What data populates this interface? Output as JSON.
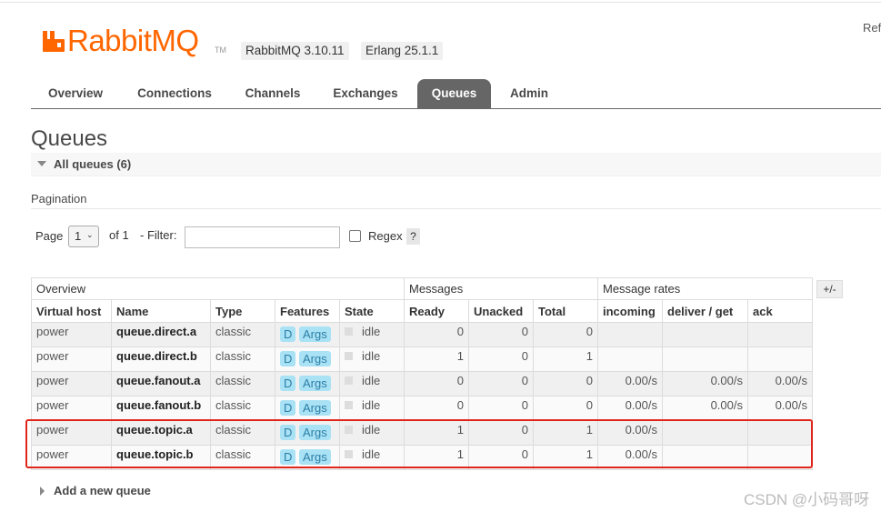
{
  "header": {
    "logo_text": "RabbitMQ",
    "logo_tm": "TM",
    "version_rabbit": "RabbitMQ 3.10.11",
    "version_erlang": "Erlang 25.1.1",
    "ref_text": "Ref",
    "brand_color": "#ff6600"
  },
  "tabs": [
    "Overview",
    "Connections",
    "Channels",
    "Exchanges",
    "Queues",
    "Admin"
  ],
  "active_tab": "Queues",
  "page_title": "Queues",
  "section_label": "All queues (6)",
  "pagination": {
    "label": "Pagination",
    "page_label": "Page",
    "page_value": "1",
    "of_label": "of 1",
    "filter_label": "- Filter:",
    "filter_value": "",
    "regex_label": "Regex",
    "help_label": "?"
  },
  "table": {
    "group_headers": [
      "Overview",
      "Messages",
      "Message rates"
    ],
    "plus_minus": "+/-",
    "columns": [
      "Virtual host",
      "Name",
      "Type",
      "Features",
      "State",
      "Ready",
      "Unacked",
      "Total",
      "incoming",
      "deliver / get",
      "ack"
    ],
    "rows": [
      {
        "vhost": "power",
        "name": "queue.direct.a",
        "type": "classic",
        "f1": "D",
        "f2": "Args",
        "state": "idle",
        "ready": "0",
        "unacked": "0",
        "total": "0",
        "incoming": "",
        "deliver": "",
        "ack": ""
      },
      {
        "vhost": "power",
        "name": "queue.direct.b",
        "type": "classic",
        "f1": "D",
        "f2": "Args",
        "state": "idle",
        "ready": "1",
        "unacked": "0",
        "total": "1",
        "incoming": "",
        "deliver": "",
        "ack": ""
      },
      {
        "vhost": "power",
        "name": "queue.fanout.a",
        "type": "classic",
        "f1": "D",
        "f2": "Args",
        "state": "idle",
        "ready": "0",
        "unacked": "0",
        "total": "0",
        "incoming": "0.00/s",
        "deliver": "0.00/s",
        "ack": "0.00/s"
      },
      {
        "vhost": "power",
        "name": "queue.fanout.b",
        "type": "classic",
        "f1": "D",
        "f2": "Args",
        "state": "idle",
        "ready": "0",
        "unacked": "0",
        "total": "0",
        "incoming": "0.00/s",
        "deliver": "0.00/s",
        "ack": "0.00/s"
      },
      {
        "vhost": "power",
        "name": "queue.topic.a",
        "type": "classic",
        "f1": "D",
        "f2": "Args",
        "state": "idle",
        "ready": "1",
        "unacked": "0",
        "total": "1",
        "incoming": "0.00/s",
        "deliver": "",
        "ack": ""
      },
      {
        "vhost": "power",
        "name": "queue.topic.b",
        "type": "classic",
        "f1": "D",
        "f2": "Args",
        "state": "idle",
        "ready": "1",
        "unacked": "0",
        "total": "1",
        "incoming": "0.00/s",
        "deliver": "",
        "ack": ""
      }
    ]
  },
  "add_queue_label": "Add a new queue",
  "watermark": "CSDN @小码哥呀",
  "highlight_color": "#e0261b"
}
